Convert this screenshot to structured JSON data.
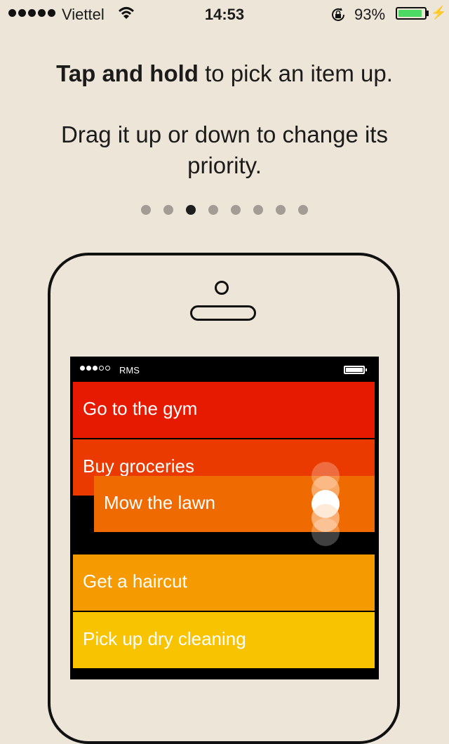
{
  "status_bar": {
    "carrier": "Viettel",
    "time": "14:53",
    "battery_percent": "93%",
    "battery_level": 0.93,
    "icons": [
      "signal-dots-icon",
      "wifi-icon",
      "rotation-lock-icon",
      "battery-icon",
      "charging-bolt-icon"
    ]
  },
  "instructions": {
    "line1_bold": "Tap and hold",
    "line1_rest": " to pick an item up.",
    "line2": "Drag it up or down to change its priority."
  },
  "pagination": {
    "count": 8,
    "active_index": 2
  },
  "mock_phone": {
    "carrier": "RMS",
    "items": [
      {
        "label": "Go to the gym",
        "color": "#e51a00"
      },
      {
        "label": "Buy groceries",
        "color": "#ea3a00"
      },
      {
        "label": "Mow the lawn",
        "color": "#ef6a00"
      },
      {
        "label": "Get a haircut",
        "color": "#f59a00"
      },
      {
        "label": "Pick up dry cleaning",
        "color": "#f8c300"
      }
    ]
  },
  "colors": {
    "background": "#ede5d8",
    "dot_inactive": "#a39c94",
    "dot_active": "#1e1e1e",
    "battery_fill": "#4cd964"
  }
}
